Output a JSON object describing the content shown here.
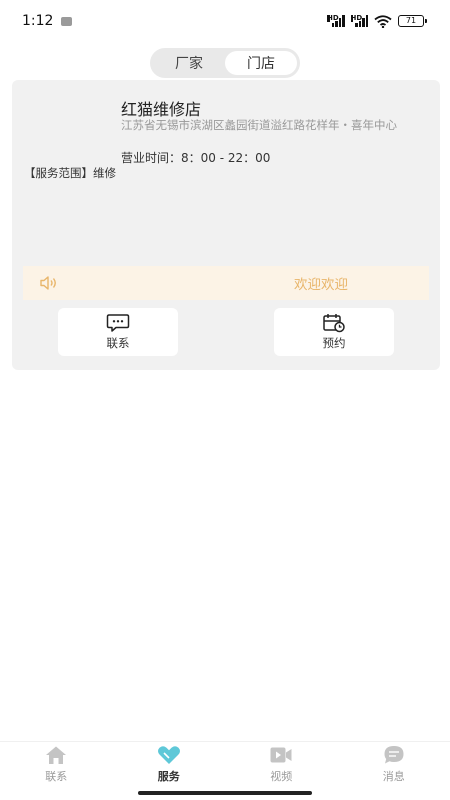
{
  "status_bar": {
    "time": "1:12",
    "battery": "71"
  },
  "segment": {
    "items": [
      "厂家",
      "门店"
    ],
    "active_index": 1
  },
  "shop": {
    "name": "红猫维修店",
    "address": "江苏省无锡市滨湖区蠡园街道溢红路花样年・喜年中心",
    "hours": "营业时间：8：00 - 22：00",
    "scope": "【服务范围】维修",
    "notice": "欢迎欢迎",
    "contact_label": "联系",
    "booking_label": "预约"
  },
  "tabbar": {
    "items": [
      {
        "label": "联系",
        "icon": "home-icon"
      },
      {
        "label": "服务",
        "icon": "heart-icon"
      },
      {
        "label": "视频",
        "icon": "video-icon"
      },
      {
        "label": "消息",
        "icon": "message-icon"
      }
    ],
    "active_index": 1
  },
  "colors": {
    "accent": "#5ec8d8",
    "notice_bg": "#fcf3e6",
    "notice_text": "#e8b56a",
    "card_bg": "#f1f1f1"
  }
}
